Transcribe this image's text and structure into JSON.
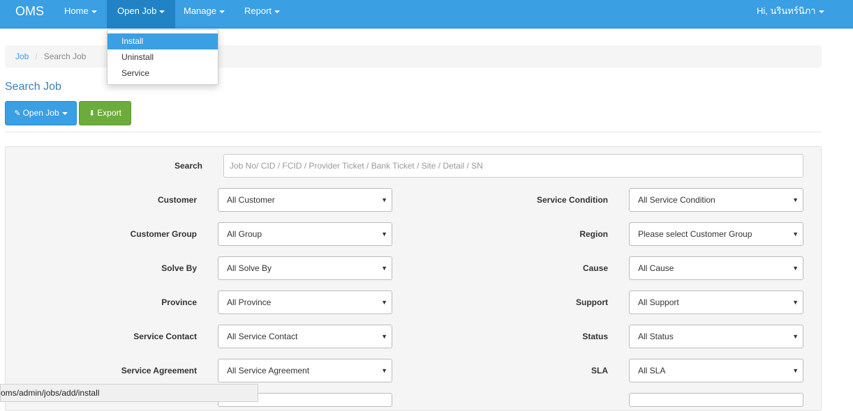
{
  "navbar": {
    "brand": "OMS",
    "items": [
      {
        "label": "Home"
      },
      {
        "label": "Open Job"
      },
      {
        "label": "Manage"
      },
      {
        "label": "Report"
      }
    ],
    "user_label": "Hi, นรินทร์นิภา"
  },
  "dropdown": {
    "items": [
      {
        "label": "Install"
      },
      {
        "label": "Uninstall"
      },
      {
        "label": "Service"
      }
    ]
  },
  "breadcrumb": {
    "items": [
      "Job",
      "Search Job"
    ],
    "separator": "/"
  },
  "page_title": "Search Job",
  "actions": {
    "open_job_label": "Open Job",
    "export_label": "Export"
  },
  "filters": {
    "search_label": "Search",
    "search_placeholder": "Job No/ CID / FCID / Provider Ticket / Bank Ticket / Site / Detail / SN",
    "left": [
      {
        "label": "Customer",
        "value": "All Customer"
      },
      {
        "label": "Customer Group",
        "value": "All Group"
      },
      {
        "label": "Solve By",
        "value": "All Solve By"
      },
      {
        "label": "Province",
        "value": "All Province"
      },
      {
        "label": "Service Contact",
        "value": "All Service Contact"
      },
      {
        "label": "Service Agreement",
        "value": "All Service Agreement"
      }
    ],
    "right": [
      {
        "label": "Service Condition",
        "value": "All Service Condition"
      },
      {
        "label": "Region",
        "value": "Please select Customer Group"
      },
      {
        "label": "Cause",
        "value": "All Cause"
      },
      {
        "label": "Support",
        "value": "All Support"
      },
      {
        "label": "Status",
        "value": "All Status"
      },
      {
        "label": "SLA",
        "value": "All SLA"
      }
    ]
  },
  "statusbar": {
    "url": "oms/admin/jobs/add/install"
  },
  "colors": {
    "navbar": "#3a9fe3",
    "nav_active": "#2183c6",
    "export_button": "#6cac3c",
    "title": "#3a7fb8"
  }
}
